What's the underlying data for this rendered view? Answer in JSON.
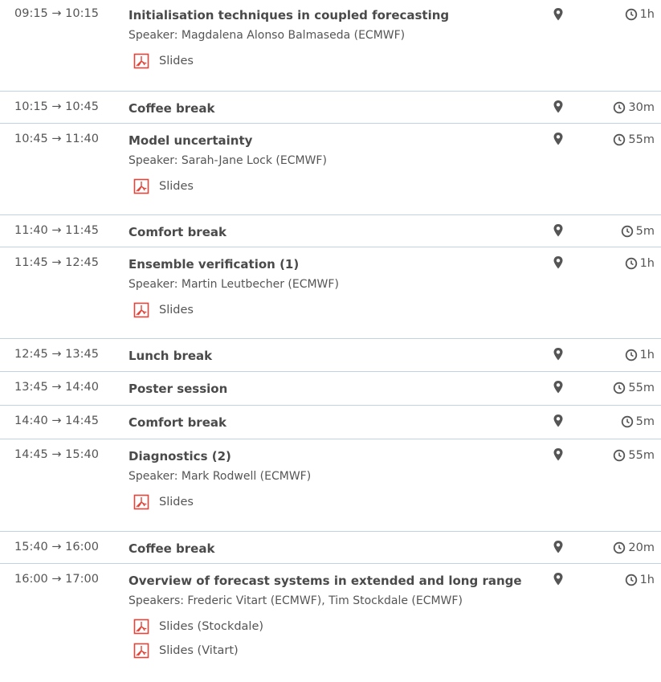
{
  "entries": [
    {
      "time": "09:15 → 10:15",
      "title": "Initialisation techniques in coupled forecasting",
      "speaker": "Speaker: Magdalena Alonso Balmaseda (ECMWF)",
      "attachments": [
        "Slides"
      ],
      "duration": "1h"
    },
    {
      "time": "10:15 → 10:45",
      "title": "Coffee break",
      "duration": "30m"
    },
    {
      "time": "10:45 → 11:40",
      "title": "Model uncertainty",
      "speaker": "Speaker: Sarah-Jane Lock (ECMWF)",
      "attachments": [
        "Slides"
      ],
      "duration": "55m"
    },
    {
      "time": "11:40 → 11:45",
      "title": "Comfort break",
      "duration": "5m"
    },
    {
      "time": "11:45 → 12:45",
      "title": "Ensemble verification (1)",
      "speaker": "Speaker: Martin Leutbecher (ECMWF)",
      "attachments": [
        "Slides"
      ],
      "duration": "1h"
    },
    {
      "time": "12:45 → 13:45",
      "title": "Lunch break",
      "duration": "1h"
    },
    {
      "time": "13:45 → 14:40",
      "title": "Poster session",
      "duration": "55m"
    },
    {
      "time": "14:40 → 14:45",
      "title": "Comfort break",
      "duration": "5m"
    },
    {
      "time": "14:45 → 15:40",
      "title": "Diagnostics (2)",
      "speaker": "Speaker: Mark Rodwell (ECMWF)",
      "attachments": [
        "Slides"
      ],
      "duration": "55m"
    },
    {
      "time": "15:40 → 16:00",
      "title": "Coffee break",
      "duration": "20m"
    },
    {
      "time": "16:00 → 17:00",
      "title": "Overview of forecast systems in extended and long range",
      "speaker": "Speakers: Frederic Vitart (ECMWF), Tim Stockdale (ECMWF)",
      "attachments": [
        "Slides (Stockdale)",
        "Slides (Vitart)"
      ],
      "duration": "1h"
    }
  ],
  "icons": {
    "location": "map-marker-icon",
    "duration": "clock-icon",
    "attachment": "pdf-file-icon"
  },
  "colors": {
    "divider": "#bed4e4",
    "pdf": "#e0453a",
    "text": "#444444"
  }
}
